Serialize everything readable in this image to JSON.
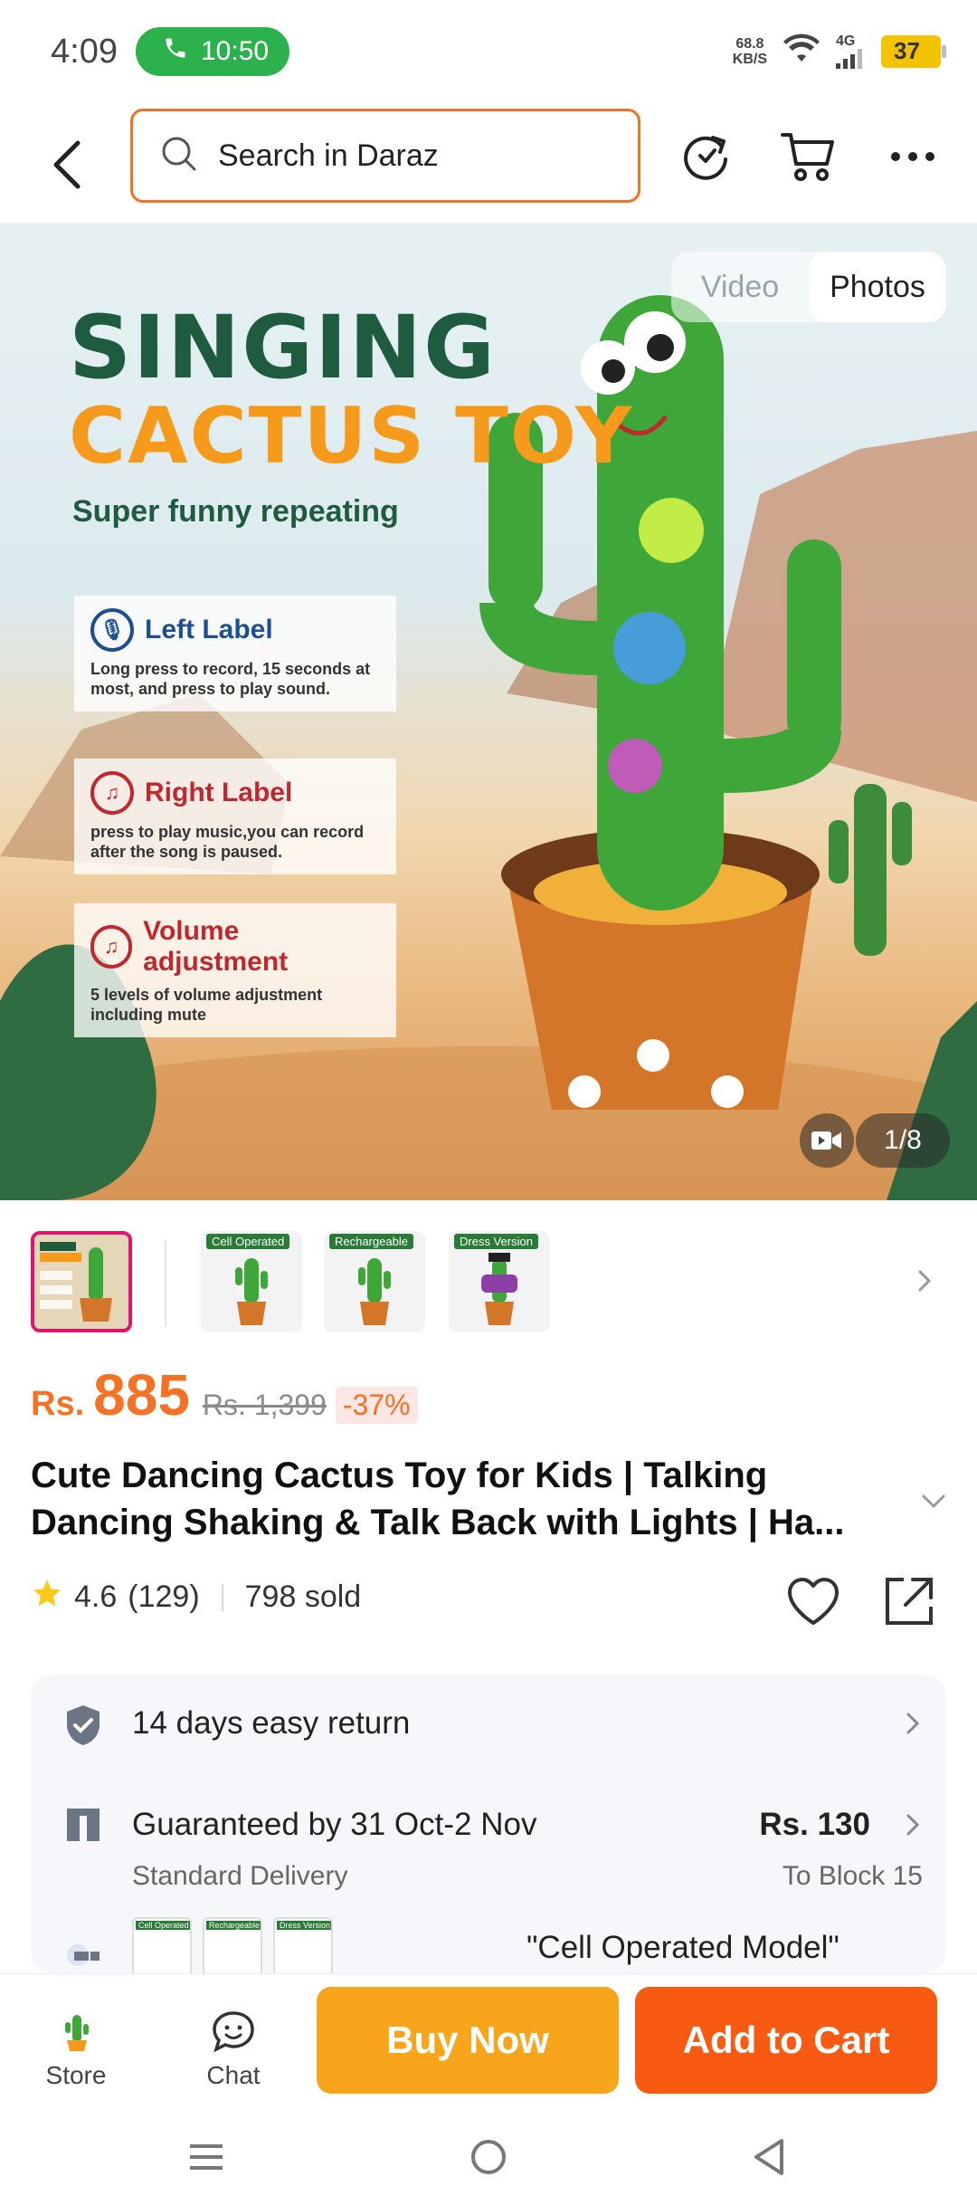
{
  "status_bar": {
    "time": "4:09",
    "call_duration": "10:50",
    "net_speed_value": "68.8",
    "net_speed_unit": "KB/S",
    "signal_label": "4G",
    "battery": "37"
  },
  "header": {
    "search_placeholder": "Search in Daraz"
  },
  "gallery": {
    "toggle_video": "Video",
    "toggle_photos": "Photos",
    "counter": "1/8",
    "poster": {
      "title_line1": "SINGING",
      "title_line2": "CACTUS TOY",
      "subtitle": "Super funny repeating",
      "cards": [
        {
          "title": "Left Label",
          "text": "Long press to record, 15 seconds at most, and press to play sound.",
          "color": "#1d4f8f"
        },
        {
          "title": "Right Label",
          "text": "press to play music,you can record after the song is paused.",
          "color": "#c0282f"
        },
        {
          "title": "Volume adjustment",
          "text": "5 levels of volume adjustment including mute",
          "color": "#c0282f"
        }
      ]
    }
  },
  "thumbnails": [
    {
      "tag": ""
    },
    {
      "tag": "Cell Operated"
    },
    {
      "tag": "Rechargeable"
    },
    {
      "tag": "Dress Version"
    }
  ],
  "price": {
    "currency": "Rs.",
    "current": "885",
    "original": "Rs. 1,399",
    "discount": "-37%"
  },
  "product": {
    "title": "Cute Dancing Cactus Toy for Kids | Talking Dancing Shaking & Talk Back with Lights | Ha...",
    "rating": "4.6",
    "reviews": "(129)",
    "sold": "798 sold"
  },
  "info": {
    "return_policy": "14 days easy return",
    "delivery_guarantee": "Guaranteed by 31 Oct-2 Nov",
    "delivery_type": "Standard Delivery",
    "delivery_fee": "Rs. 130",
    "delivery_location": "To Block 15",
    "variant_selected": "\"Cell Operated Model\"",
    "variant_tags": [
      "Cell Operated",
      "Rechargeable",
      "Dress Version"
    ]
  },
  "bottom_bar": {
    "store": "Store",
    "chat": "Chat",
    "buy_now": "Buy Now",
    "add_to_cart": "Add to Cart"
  },
  "colors": {
    "accent": "#f57224",
    "buy_now": "#f9a51b",
    "add_to_cart": "#f85a11",
    "call_pill": "#2bb24c"
  }
}
